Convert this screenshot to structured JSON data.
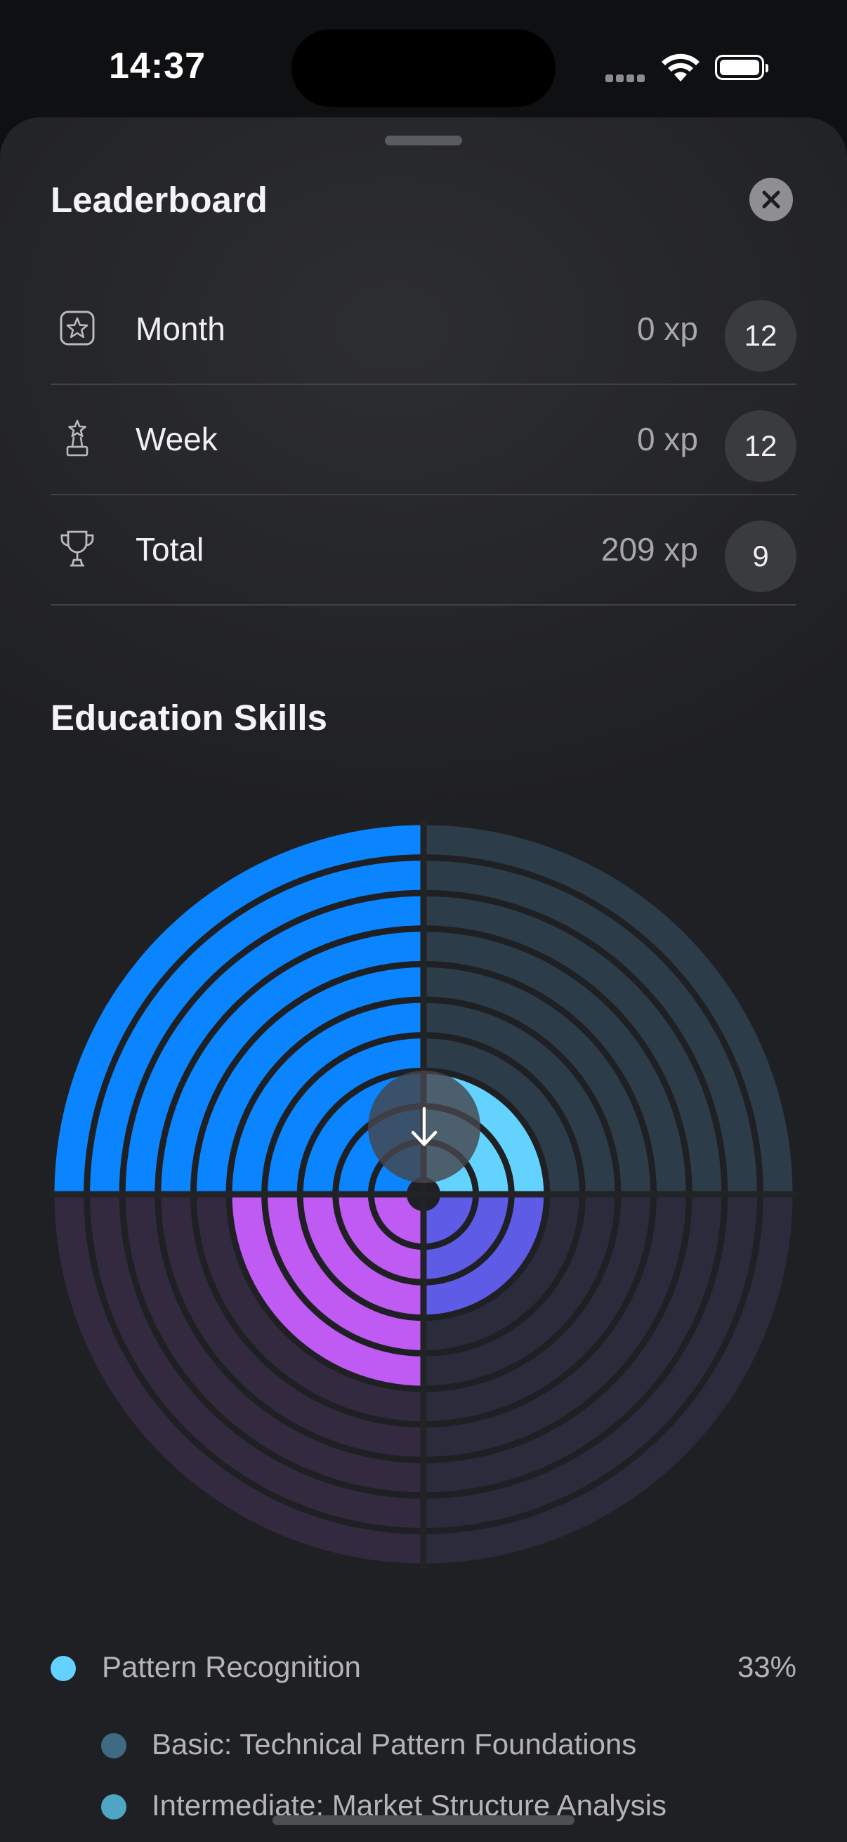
{
  "status_bar": {
    "time": "14:37"
  },
  "sheet": {
    "title": "Leaderboard",
    "close_icon": "close-icon"
  },
  "leaderboard": [
    {
      "label": "Month",
      "xp": "0 xp",
      "rank": "12",
      "icon": "star-badge-icon"
    },
    {
      "label": "Week",
      "xp": "0 xp",
      "rank": "12",
      "icon": "award-figure-icon"
    },
    {
      "label": "Total",
      "xp": "209 xp",
      "rank": "9",
      "icon": "trophy-icon"
    }
  ],
  "skills": {
    "title": "Education Skills",
    "chart_data": {
      "type": "radial-quadrant",
      "rings_total": 10,
      "quadrants": [
        {
          "position": "top-left",
          "color": "#0a84ff",
          "filled_rings": 10
        },
        {
          "position": "top-right",
          "color": "#64d2ff",
          "filled_rings": 3
        },
        {
          "position": "bottom-right",
          "color": "#5e5ce6",
          "filled_rings": 3
        },
        {
          "position": "bottom-left",
          "color": "#bf5af2",
          "filled_rings": 5
        }
      ]
    }
  },
  "legend": {
    "category": {
      "label": "Pattern Recognition",
      "percent": "33%",
      "color": "#64d2ff"
    },
    "items": [
      {
        "label": "Basic: Technical Pattern Foundations",
        "color": "#3f6b82"
      },
      {
        "label": "Intermediate: Market Structure Analysis",
        "color": "#4fa6c4"
      }
    ]
  },
  "scroll_button": {
    "icon": "arrow-down-icon"
  }
}
